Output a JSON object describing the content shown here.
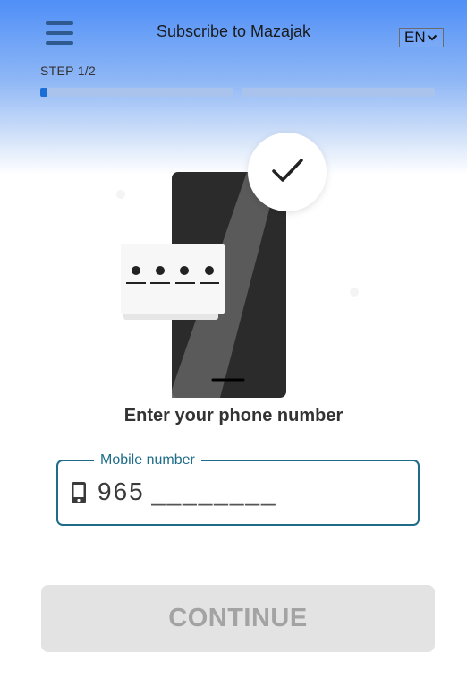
{
  "header": {
    "title": "Subscribe to Mazajak",
    "menu_icon": "hamburger-menu-icon",
    "language": {
      "selected": "EN",
      "icon": "chevron-down-icon"
    }
  },
  "progress": {
    "label": "STEP 1/2",
    "current_step": 1,
    "total_steps": 2,
    "segments": [
      {
        "fill_fraction": 0.03
      },
      {
        "fill_fraction": 0
      }
    ],
    "fill_color": "#1a6fd6",
    "track_color": "#a9c3ec"
  },
  "illustration": {
    "icon": "phone-verification-icon",
    "pin_dots": 4
  },
  "main": {
    "prompt": "Enter your phone number"
  },
  "phone_field": {
    "label": "Mobile number",
    "icon": "mobile-phone-icon",
    "prefix": "965",
    "value": "",
    "placeholder": "________",
    "border_color": "#1e6c8a"
  },
  "actions": {
    "continue_label": "CONTINUE",
    "continue_enabled": false
  },
  "colors": {
    "header_gradient_top": "#4f8ff7",
    "accent": "#1e6c8a",
    "button_disabled_bg": "#e3e3e3",
    "button_disabled_text": "#a3a3a3"
  }
}
